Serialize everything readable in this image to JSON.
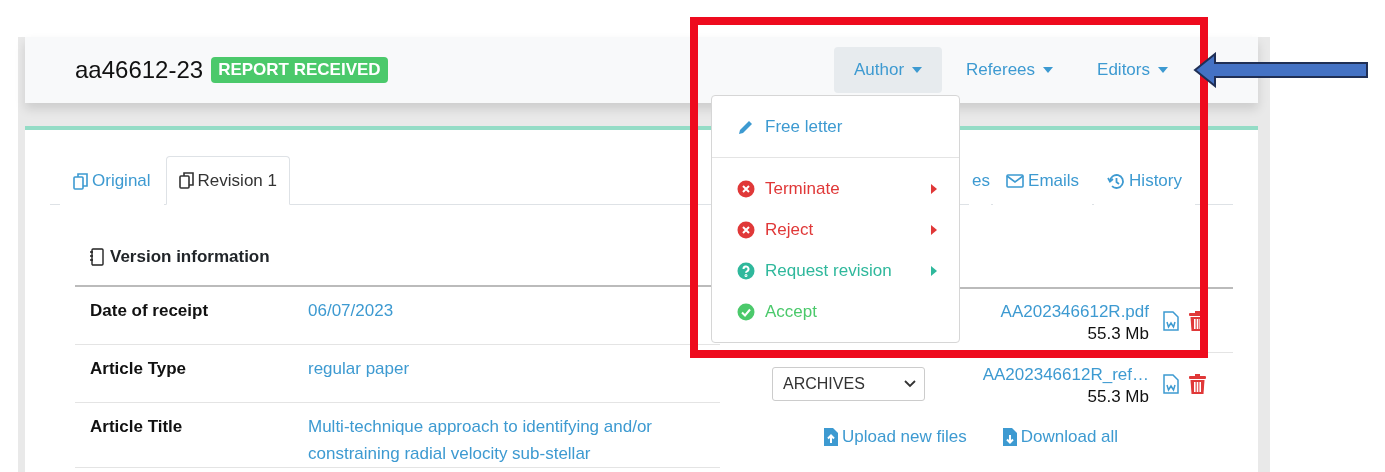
{
  "header": {
    "manuscript_id": "aa46612-23",
    "status_badge": "REPORT RECEIVED"
  },
  "nav_menus": [
    {
      "label": "Author",
      "expanded": true
    },
    {
      "label": "Referees",
      "expanded": false
    },
    {
      "label": "Editors",
      "expanded": false
    }
  ],
  "author_menu": [
    {
      "kind": "letter",
      "label": "Free letter",
      "submenu": false
    },
    {
      "kind": "terminate",
      "label": "Terminate",
      "submenu": true
    },
    {
      "kind": "reject",
      "label": "Reject",
      "submenu": true
    },
    {
      "kind": "revision",
      "label": "Request revision",
      "submenu": true
    },
    {
      "kind": "accept",
      "label": "Accept",
      "submenu": false
    }
  ],
  "tabs": [
    {
      "kind": "version",
      "label": "Original",
      "selected": false
    },
    {
      "kind": "version",
      "label": "Revision 1",
      "selected": true
    },
    {
      "kind": "plain",
      "label": "es",
      "selected": false
    },
    {
      "kind": "emails",
      "label": "Emails",
      "selected": false
    },
    {
      "kind": "history",
      "label": "History",
      "selected": false
    }
  ],
  "version_info": {
    "title": "Version information",
    "rows": [
      {
        "label": "Date of receipt",
        "value": "06/07/2023"
      },
      {
        "label": "Article Type",
        "value": "regular paper"
      },
      {
        "label": "Article Title",
        "value": "Multi-technique approach to identifying and/or constraining radial velocity sub-stellar"
      }
    ]
  },
  "files": {
    "rows": [
      {
        "name": "AA202346612R.pdf",
        "size": "55.3 Mb"
      },
      {
        "category": "ARCHIVES",
        "name": "AA202346612R_ref…",
        "size": "55.3 Mb"
      }
    ],
    "actions": [
      {
        "kind": "upload",
        "label": "Upload new files"
      },
      {
        "kind": "download",
        "label": "Download all"
      }
    ]
  },
  "annotations": [
    {
      "kind": "highlight-box"
    },
    {
      "kind": "arrow"
    }
  ]
}
